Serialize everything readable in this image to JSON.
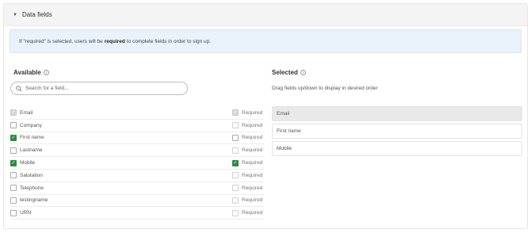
{
  "header": {
    "title": "Data fields",
    "caret_icon": "chevron-down-icon"
  },
  "banner": {
    "text_before": "If \"required\" is selected, users will be",
    "bold": "required",
    "text_after": "to complete fields in order to sign up."
  },
  "available": {
    "title": "Available",
    "search_placeholder": "Search for a field..."
  },
  "selected": {
    "title": "Selected",
    "hint": "Drag fields up/down to display in desired order",
    "items": [
      "Email",
      "First name",
      "Mobile"
    ]
  },
  "required_label": "Required",
  "fields": [
    {
      "label": "Email",
      "checked": true,
      "disabled": true,
      "required": true,
      "required_disabled": true
    },
    {
      "label": "Company",
      "checked": false,
      "disabled": false,
      "required": false,
      "required_disabled": true
    },
    {
      "label": "First name",
      "checked": true,
      "disabled": false,
      "required": false,
      "required_disabled": false
    },
    {
      "label": "Lastname",
      "checked": false,
      "disabled": false,
      "required": false,
      "required_disabled": true
    },
    {
      "label": "Mobile",
      "checked": true,
      "disabled": false,
      "required": true,
      "required_disabled": false
    },
    {
      "label": "Salutation",
      "checked": false,
      "disabled": false,
      "required": false,
      "required_disabled": true
    },
    {
      "label": "Telephone",
      "checked": false,
      "disabled": false,
      "required": false,
      "required_disabled": true
    },
    {
      "label": "testingname",
      "checked": false,
      "disabled": false,
      "required": false,
      "required_disabled": true
    },
    {
      "label": "URN",
      "checked": false,
      "disabled": false,
      "required": false,
      "required_disabled": true
    }
  ],
  "colors": {
    "check_green": "#2e8a3f",
    "banner_bg": "#e9f2fb",
    "header_bg": "#f4f4f4"
  }
}
